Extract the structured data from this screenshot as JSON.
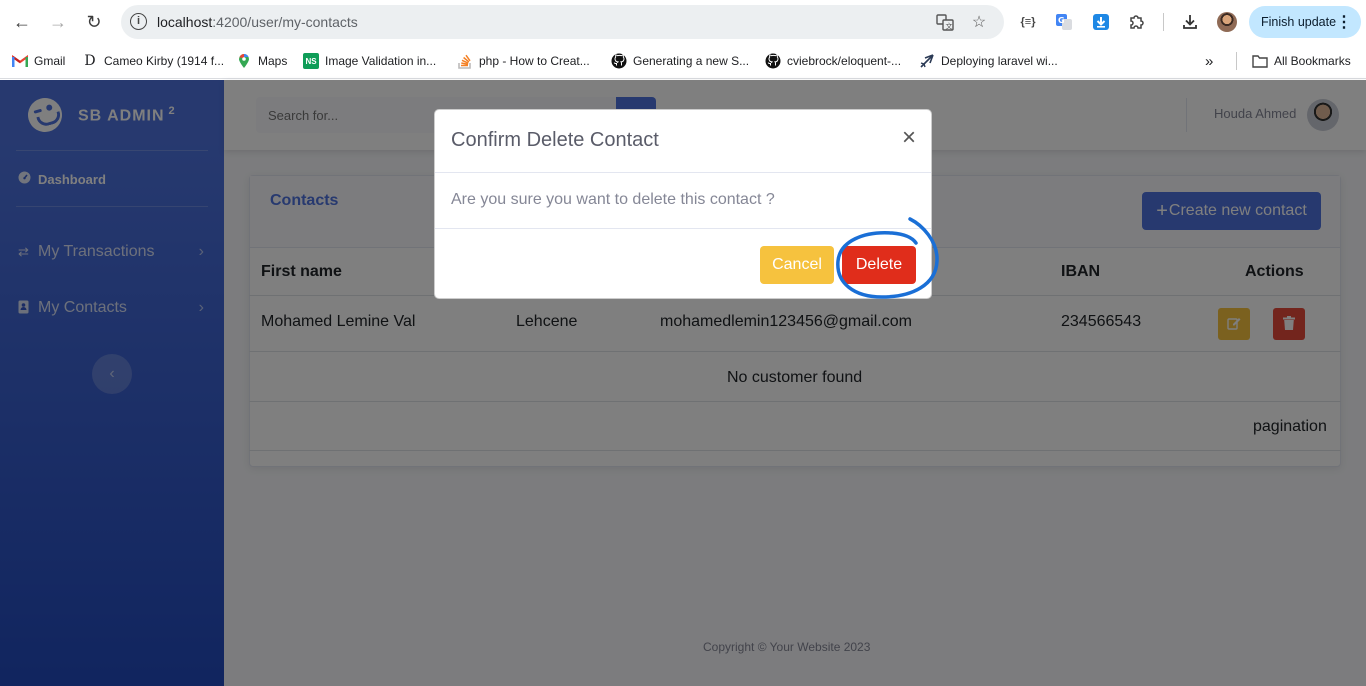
{
  "browser": {
    "url_host": "localhost",
    "url_rest": ":4200/user/my-contacts",
    "info_icon": "i",
    "finish_update": "Finish update",
    "bookmarks": [
      {
        "label": "Gmail",
        "icon": "gmail-icon",
        "glyph": "M",
        "color": "#ea4335"
      },
      {
        "label": "Cameo Kirby (1914 f...",
        "icon": "d-favicon-icon",
        "glyph": "D",
        "color": "#111111"
      },
      {
        "label": "Maps",
        "icon": "maps-icon",
        "glyph": "●",
        "color": "#34a853"
      },
      {
        "label": "Image Validation in...",
        "icon": "ns-icon",
        "glyph": "NS",
        "color": "#0f9d58"
      },
      {
        "label": "php - How to Creat...",
        "icon": "stackoverflow-icon",
        "glyph": "≣",
        "color": "#f48024"
      },
      {
        "label": "Generating a new S...",
        "icon": "github-icon",
        "glyph": "●",
        "color": "#111111"
      },
      {
        "label": "cviebrock/eloquent-...",
        "icon": "github-icon",
        "glyph": "●",
        "color": "#111111"
      },
      {
        "label": "Deploying laravel wi...",
        "icon": "deploy-icon",
        "glyph": "➚",
        "color": "#2b3a55"
      }
    ],
    "more_bookmarks": "»",
    "all_bookmarks": "All Bookmarks"
  },
  "sidebar": {
    "brand": "SB ADMIN",
    "brand_sup": "2",
    "items": [
      {
        "label": "Dashboard"
      },
      {
        "label": "My Transactions"
      },
      {
        "label": "My Contacts"
      }
    ]
  },
  "topbar": {
    "search_placeholder": "Search for...",
    "user_name": "Houda Ahmed"
  },
  "card": {
    "title": "Contacts",
    "create_label": "Create new contact",
    "columns": [
      "First name",
      "IBAN",
      "Actions"
    ],
    "row": {
      "first_name": "Mohamed Lemine Val",
      "last_name": "Lehcene",
      "email": "mohamedlemin123456@gmail.com",
      "iban": "234566543"
    },
    "empty_text": "No customer found",
    "pagination": "pagination"
  },
  "footer": "Copyright © Your Website 2023",
  "modal": {
    "title": "Confirm Delete Contact",
    "close": "×",
    "body": "Are you sure you want to delete this contact ?",
    "cancel": "Cancel",
    "delete": "Delete"
  },
  "colors": {
    "primary": "#4e73df",
    "warning": "#f6c23e",
    "danger": "#e74a3b",
    "annotation": "#1a6fd6"
  }
}
